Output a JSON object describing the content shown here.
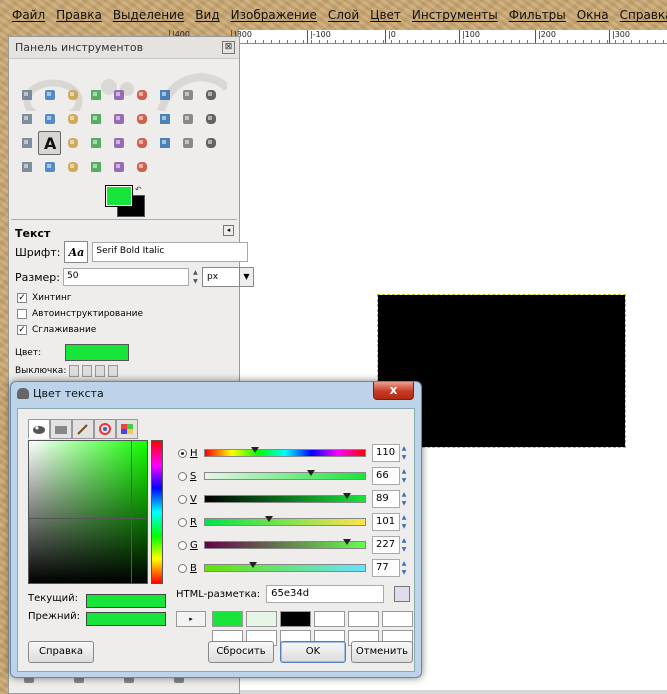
{
  "menubar": [
    "Файл",
    "Правка",
    "Выделение",
    "Вид",
    "Изображение",
    "Слой",
    "Цвет",
    "Инструменты",
    "Фильтры",
    "Окна",
    "Справка"
  ],
  "ruler": {
    "left_labels": [
      "|400",
      "|300"
    ],
    "right_labels": [
      "|-100",
      "|0",
      "|100",
      "|200",
      "|300"
    ]
  },
  "toolbox": {
    "title": "Панель инструментов",
    "close": "⊠",
    "tools": [
      "rect-select-icon",
      "ellipse-select-icon",
      "lasso-icon",
      "fuzzy-select-icon",
      "color-select-icon",
      "scissors-icon",
      "foreground-select-icon",
      "paths-icon",
      "color-picker-icon",
      "zoom-icon",
      "measure-icon",
      "move-icon",
      "align-icon",
      "crop-icon",
      "rotate-icon",
      "scale-icon",
      "shear-icon",
      "perspective-icon",
      "flip-icon",
      "text-icon",
      "bucket-fill-icon",
      "blend-icon",
      "pencil-icon",
      "paintbrush-icon",
      "eraser-icon",
      "airbrush-icon",
      "ink-icon",
      "clone-icon",
      "heal-icon",
      "perspective-clone-icon",
      "blur-icon",
      "smudge-icon",
      "dodge-burn-icon"
    ],
    "active_tool": "text-icon",
    "fg_color": "#18e53a",
    "bg_color": "#000000"
  },
  "options": {
    "title": "Текст",
    "font_label": "Шрифт:",
    "font_preview": "Aa",
    "font_value": "Serif Bold Italic",
    "size_label": "Размер:",
    "size_value": "50",
    "unit": "px",
    "hinting": "Хинтинг",
    "autohint": "Автоинструктирование",
    "antialias": "Сглаживание",
    "color_label": "Цвет:",
    "color_value": "#18e53a",
    "justify_label": "Выключка:"
  },
  "dialog": {
    "title": "Цвет текста",
    "close": "x",
    "current_label": "Текущий:",
    "previous_label": "Прежний:",
    "channels": [
      {
        "key": "H",
        "value": "110",
        "pos": 0.31,
        "selected": true,
        "gradient": "linear-gradient(to right,#f00,#ff0,#0f0,#0ff,#00f,#f0f,#f00)"
      },
      {
        "key": "S",
        "value": "66",
        "pos": 0.66,
        "selected": false,
        "gradient": "linear-gradient(to right,#e8f5e8,#18e53a)"
      },
      {
        "key": "V",
        "value": "89",
        "pos": 0.89,
        "selected": false,
        "gradient": "linear-gradient(to right,#000,#18e53a)"
      },
      {
        "key": "R",
        "value": "101",
        "pos": 0.4,
        "selected": false,
        "gradient": "linear-gradient(to right,#00e34d,#ffe34d)"
      },
      {
        "key": "G",
        "value": "227",
        "pos": 0.89,
        "selected": false,
        "gradient": "linear-gradient(to right,#65004d,#65ff4d)"
      },
      {
        "key": "B",
        "value": "77",
        "pos": 0.3,
        "selected": false,
        "gradient": "linear-gradient(to right,#65e300,#65e3ff)"
      }
    ],
    "html_label": "HTML-разметка:",
    "html_value": "65e34d",
    "history_colors": [
      "#18e53a",
      "#e6f5e6",
      "#000000",
      "#ffffff",
      "#ffffff",
      "#ffffff",
      "#ffffff",
      "#ffffff",
      "#ffffff",
      "#ffffff",
      "#ffffff",
      "#ffffff"
    ],
    "buttons": {
      "help": "Справка",
      "reset": "Сбросить",
      "ok": "OK",
      "cancel": "Отменить"
    }
  }
}
